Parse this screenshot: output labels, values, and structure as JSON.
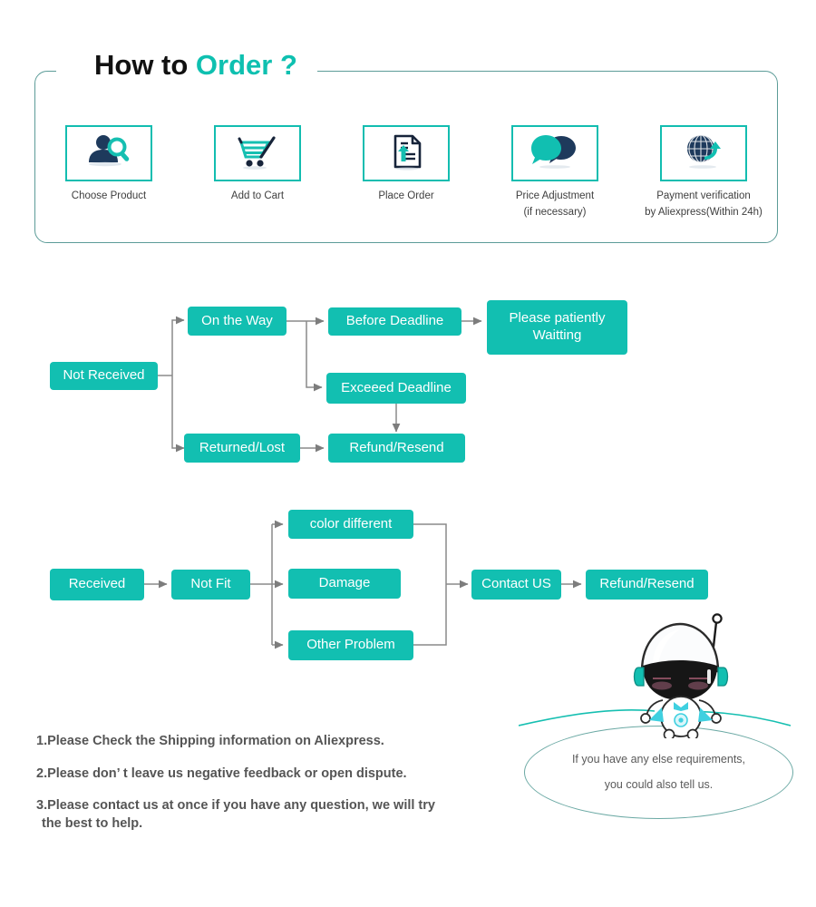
{
  "header": {
    "title_black": "How to ",
    "title_teal": "Order ?",
    "accent_color": "#0ec0b0",
    "panel_border_color": "#5c9c98",
    "steps": [
      {
        "icon": "person-search-icon",
        "label_line1": "Choose  Product",
        "label_line2": ""
      },
      {
        "icon": "shopping-cart-icon",
        "label_line1": "Add to Cart",
        "label_line2": ""
      },
      {
        "icon": "document-upload-icon",
        "label_line1": "Place  Order",
        "label_line2": ""
      },
      {
        "icon": "chat-bubbles-icon",
        "label_line1": "Price Adjustment",
        "label_line2": "(if necessary)"
      },
      {
        "icon": "globe-arrow-icon",
        "label_line1": "Payment verification",
        "label_line2": "by Aliexpress(Within 24h)"
      }
    ]
  },
  "flow_not_received": {
    "node_color": "#12bfb1",
    "connector_color": "#8a8a8a",
    "nodes": {
      "not_received": "Not Received",
      "on_the_way": "On the Way",
      "before_deadline": "Before Deadline",
      "please_wait_l1": "Please patiently",
      "please_wait_l2": "Waitting",
      "exceed_deadline": "Exceeed Deadline",
      "returned_lost": "Returned/Lost",
      "refund_resend": "Refund/Resend"
    }
  },
  "flow_received": {
    "nodes": {
      "received": "Received",
      "not_fit": "Not Fit",
      "color_different": "color different",
      "damage": "Damage",
      "other_problem": "Other Problem",
      "contact_us": "Contact US",
      "refund_resend": "Refund/Resend"
    }
  },
  "notes": [
    {
      "text": "1.Please Check the Shipping information on Aliexpress.",
      "cont": ""
    },
    {
      "text": "2.Please don’ t leave us negative feedback or open dispute.",
      "cont": ""
    },
    {
      "text": "3.Please contact us at once if you have any question, we will try",
      "cont": " the best to help."
    }
  ],
  "bubble": {
    "line1": "If you have any else requirements,",
    "line2": "you could also tell us.",
    "border_color": "#6ba9a4"
  },
  "mascot": {
    "name": "astronaut-mascot"
  }
}
